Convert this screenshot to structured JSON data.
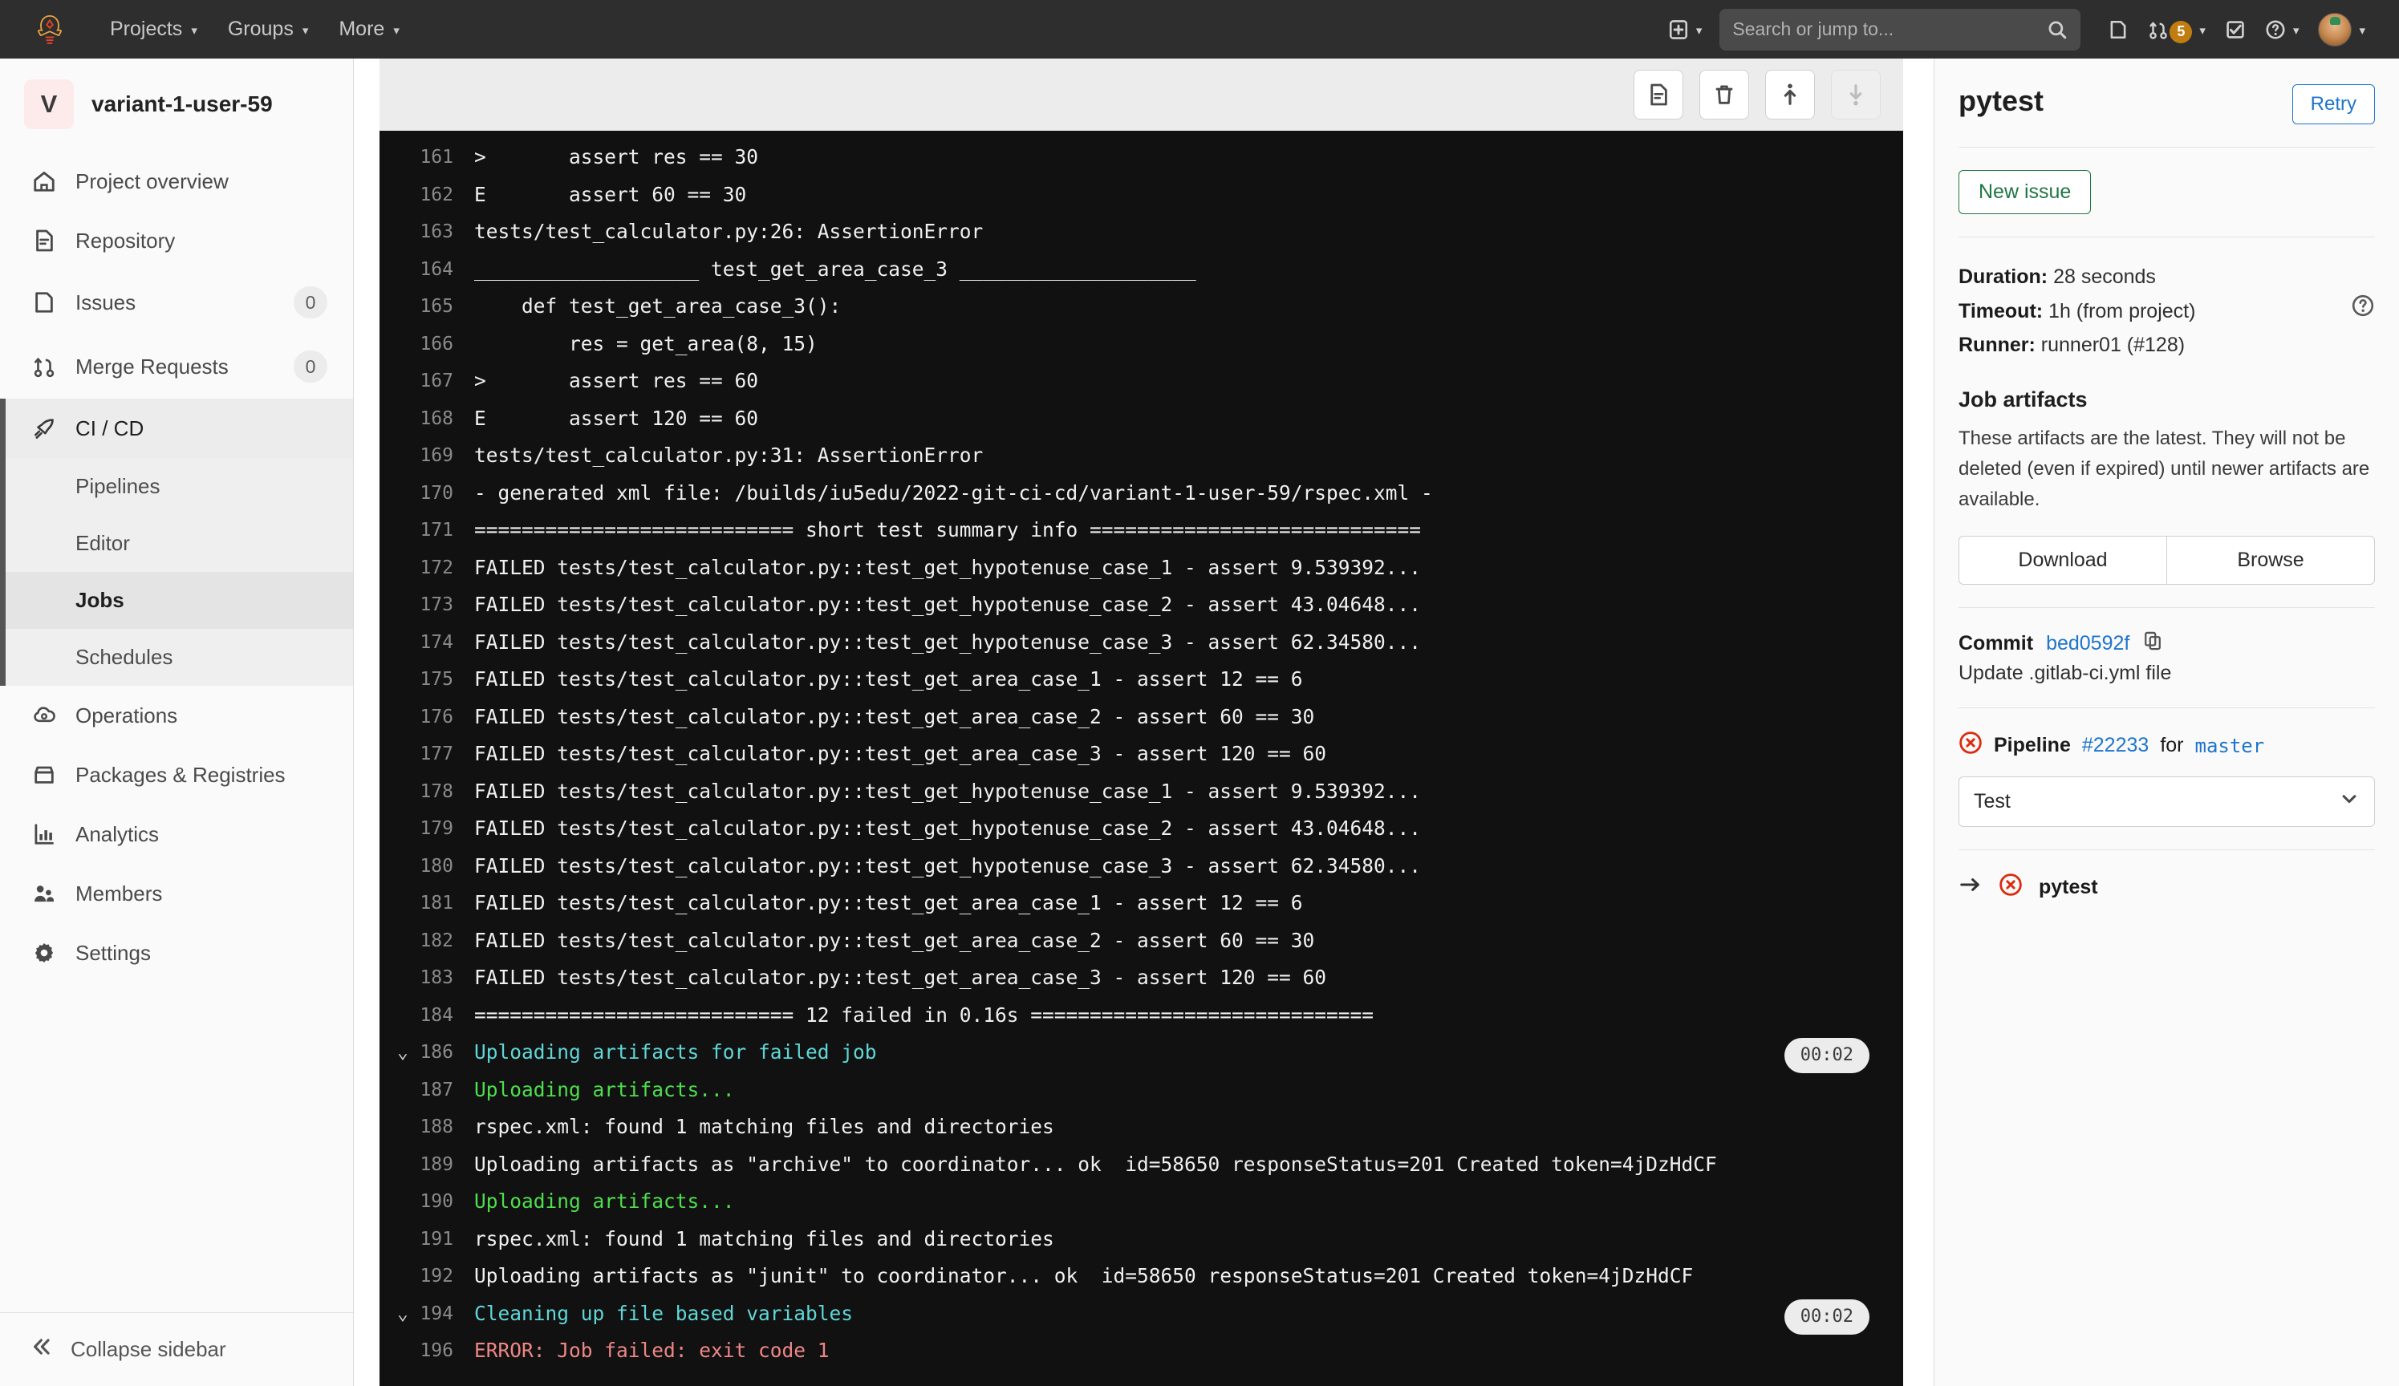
{
  "topnav": {
    "logo_icon": "gitlab-tanuki-logo",
    "links": [
      {
        "label": "Projects",
        "icon": "chevron-down-icon"
      },
      {
        "label": "Groups",
        "icon": "chevron-down-icon"
      },
      {
        "label": "More",
        "icon": "chevron-down-icon"
      }
    ],
    "search": {
      "value": "",
      "placeholder": "Search or jump to..."
    },
    "plus_icon": "plus-square-icon",
    "issues_icon": "issues-icon",
    "merge_requests_icon": "merge-request-icon",
    "merge_requests_count": "5",
    "todos_icon": "todo-check-icon",
    "help_icon": "question-circle-icon",
    "avatar_icon": "user-avatar"
  },
  "sidebar": {
    "project": {
      "initial": "V",
      "name": "variant-1-user-59"
    },
    "items": [
      {
        "label": "Project overview",
        "icon": "home-icon",
        "badge": null,
        "active": false
      },
      {
        "label": "Repository",
        "icon": "document-icon",
        "badge": null,
        "active": false
      },
      {
        "label": "Issues",
        "icon": "issues-icon",
        "badge": "0",
        "active": false
      },
      {
        "label": "Merge Requests",
        "icon": "merge-request-icon",
        "badge": "0",
        "active": false
      },
      {
        "label": "CI / CD",
        "icon": "rocket-icon",
        "badge": null,
        "active": true
      }
    ],
    "subitems": [
      {
        "label": "Pipelines",
        "current": false
      },
      {
        "label": "Editor",
        "current": false
      },
      {
        "label": "Jobs",
        "current": true
      },
      {
        "label": "Schedules",
        "current": false
      }
    ],
    "items_after": [
      {
        "label": "Operations",
        "icon": "cloud-gear-icon",
        "badge": null
      },
      {
        "label": "Packages & Registries",
        "icon": "package-icon",
        "badge": null
      },
      {
        "label": "Analytics",
        "icon": "chart-bar-icon",
        "badge": null
      },
      {
        "label": "Members",
        "icon": "users-icon",
        "badge": null
      },
      {
        "label": "Settings",
        "icon": "gear-icon",
        "badge": null
      }
    ],
    "collapse": {
      "label": "Collapse sidebar",
      "icon": "chevron-double-left-icon"
    }
  },
  "log_toolbar": {
    "buttons": [
      {
        "name": "show-raw-button",
        "icon": "document-icon",
        "disabled": false
      },
      {
        "name": "erase-job-log-button",
        "icon": "trash-icon",
        "disabled": false
      },
      {
        "name": "scroll-to-top-button",
        "icon": "scroll-up-icon",
        "disabled": false
      },
      {
        "name": "scroll-to-bottom-button",
        "icon": "scroll-down-icon",
        "disabled": true
      }
    ]
  },
  "log": {
    "lines": [
      {
        "num": "161",
        "text": ">       assert res == 30",
        "color": "white",
        "toggle": false,
        "time": null
      },
      {
        "num": "162",
        "text": "E       assert 60 == 30",
        "color": "white",
        "toggle": false,
        "time": null
      },
      {
        "num": "163",
        "text": "tests/test_calculator.py:26: AssertionError",
        "color": "white",
        "toggle": false,
        "time": null
      },
      {
        "num": "164",
        "text": "___________________ test_get_area_case_3 ____________________",
        "color": "white",
        "toggle": false,
        "time": null
      },
      {
        "num": "165",
        "text": "    def test_get_area_case_3():",
        "color": "white",
        "toggle": false,
        "time": null
      },
      {
        "num": "166",
        "text": "        res = get_area(8, 15)",
        "color": "white",
        "toggle": false,
        "time": null
      },
      {
        "num": "167",
        "text": ">       assert res == 60",
        "color": "white",
        "toggle": false,
        "time": null
      },
      {
        "num": "168",
        "text": "E       assert 120 == 60",
        "color": "white",
        "toggle": false,
        "time": null
      },
      {
        "num": "169",
        "text": "tests/test_calculator.py:31: AssertionError",
        "color": "white",
        "toggle": false,
        "time": null
      },
      {
        "num": "170",
        "text": "- generated xml file: /builds/iu5edu/2022-git-ci-cd/variant-1-user-59/rspec.xml -",
        "color": "white",
        "toggle": false,
        "time": null
      },
      {
        "num": "171",
        "text": "=========================== short test summary info ============================",
        "color": "white",
        "toggle": false,
        "time": null
      },
      {
        "num": "172",
        "text": "FAILED tests/test_calculator.py::test_get_hypotenuse_case_1 - assert 9.539392...",
        "color": "white",
        "toggle": false,
        "time": null
      },
      {
        "num": "173",
        "text": "FAILED tests/test_calculator.py::test_get_hypotenuse_case_2 - assert 43.04648...",
        "color": "white",
        "toggle": false,
        "time": null
      },
      {
        "num": "174",
        "text": "FAILED tests/test_calculator.py::test_get_hypotenuse_case_3 - assert 62.34580...",
        "color": "white",
        "toggle": false,
        "time": null
      },
      {
        "num": "175",
        "text": "FAILED tests/test_calculator.py::test_get_area_case_1 - assert 12 == 6",
        "color": "white",
        "toggle": false,
        "time": null
      },
      {
        "num": "176",
        "text": "FAILED tests/test_calculator.py::test_get_area_case_2 - assert 60 == 30",
        "color": "white",
        "toggle": false,
        "time": null
      },
      {
        "num": "177",
        "text": "FAILED tests/test_calculator.py::test_get_area_case_3 - assert 120 == 60",
        "color": "white",
        "toggle": false,
        "time": null
      },
      {
        "num": "178",
        "text": "FAILED tests/test_calculator.py::test_get_hypotenuse_case_1 - assert 9.539392...",
        "color": "white",
        "toggle": false,
        "time": null
      },
      {
        "num": "179",
        "text": "FAILED tests/test_calculator.py::test_get_hypotenuse_case_2 - assert 43.04648...",
        "color": "white",
        "toggle": false,
        "time": null
      },
      {
        "num": "180",
        "text": "FAILED tests/test_calculator.py::test_get_hypotenuse_case_3 - assert 62.34580...",
        "color": "white",
        "toggle": false,
        "time": null
      },
      {
        "num": "181",
        "text": "FAILED tests/test_calculator.py::test_get_area_case_1 - assert 12 == 6",
        "color": "white",
        "toggle": false,
        "time": null
      },
      {
        "num": "182",
        "text": "FAILED tests/test_calculator.py::test_get_area_case_2 - assert 60 == 30",
        "color": "white",
        "toggle": false,
        "time": null
      },
      {
        "num": "183",
        "text": "FAILED tests/test_calculator.py::test_get_area_case_3 - assert 120 == 60",
        "color": "white",
        "toggle": false,
        "time": null
      },
      {
        "num": "184",
        "text": "=========================== 12 failed in 0.16s =============================",
        "color": "white",
        "toggle": false,
        "time": null
      },
      {
        "num": "186",
        "text": "Uploading artifacts for failed job",
        "color": "cyan",
        "toggle": true,
        "time": "00:02"
      },
      {
        "num": "187",
        "text": "Uploading artifacts...",
        "color": "green",
        "toggle": false,
        "time": null
      },
      {
        "num": "188",
        "text": "rspec.xml: found 1 matching files and directories",
        "color": "white",
        "toggle": false,
        "time": null
      },
      {
        "num": "189",
        "text": "Uploading artifacts as \"archive\" to coordinator... ok  id=58650 responseStatus=201 Created token=4jDzHdCF",
        "color": "white",
        "toggle": false,
        "time": null
      },
      {
        "num": "190",
        "text": "Uploading artifacts...",
        "color": "green",
        "toggle": false,
        "time": null
      },
      {
        "num": "191",
        "text": "rspec.xml: found 1 matching files and directories",
        "color": "white",
        "toggle": false,
        "time": null
      },
      {
        "num": "192",
        "text": "Uploading artifacts as \"junit\" to coordinator... ok  id=58650 responseStatus=201 Created token=4jDzHdCF",
        "color": "white",
        "toggle": false,
        "time": null
      },
      {
        "num": "194",
        "text": "Cleaning up file based variables",
        "color": "cyan",
        "toggle": true,
        "time": "00:02"
      },
      {
        "num": "196",
        "text": "ERROR: Job failed: exit code 1",
        "color": "red",
        "toggle": false,
        "time": null
      }
    ]
  },
  "rightpanel": {
    "job_name": "pytest",
    "retry_label": "Retry",
    "new_issue_label": "New issue",
    "duration_key": "Duration:",
    "duration_value": "28 seconds",
    "timeout_key": "Timeout:",
    "timeout_value": "1h (from project)",
    "runner_key": "Runner:",
    "runner_value": "runner01 (#128)",
    "help_icon": "question-circle-icon",
    "artifacts_title": "Job artifacts",
    "artifacts_text": "These artifacts are the latest. They will not be deleted (even if expired) until newer artifacts are available.",
    "download_label": "Download",
    "browse_label": "Browse",
    "commit_key": "Commit",
    "commit_sha": "bed0592f",
    "copy_icon": "copy-clipboard-icon",
    "commit_message": "Update .gitlab-ci.yml file",
    "pipeline_status_icon": "status-failed-icon",
    "pipeline_key": "Pipeline",
    "pipeline_id": "#22233",
    "pipeline_for": "for",
    "pipeline_ref": "master",
    "stage_select_value": "Test",
    "stage_select_icon": "chevron-down-icon",
    "stage_arrow_icon": "arrow-right-icon",
    "stage_job_status_icon": "status-failed-icon",
    "stage_job_name": "pytest"
  }
}
